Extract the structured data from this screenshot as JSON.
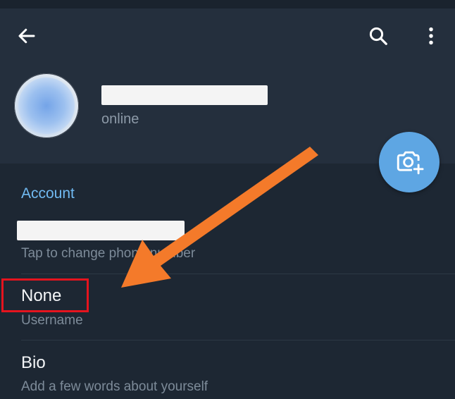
{
  "header": {
    "status": "online"
  },
  "account": {
    "section_title": "Account",
    "phone_hint": "Tap to change phone number",
    "username_value": "None",
    "username_label": "Username",
    "bio_title": "Bio",
    "bio_hint": "Add a few words about yourself"
  },
  "icons": {
    "back": "arrow-left-icon",
    "search": "search-icon",
    "more": "more-vertical-icon",
    "camera": "camera-add-icon"
  },
  "colors": {
    "background": "#1d2733",
    "header": "#242f3d",
    "accent": "#71baf2",
    "fab": "#5ea6e3",
    "highlight": "#e5141e",
    "annotation_arrow": "#f47a2a"
  }
}
